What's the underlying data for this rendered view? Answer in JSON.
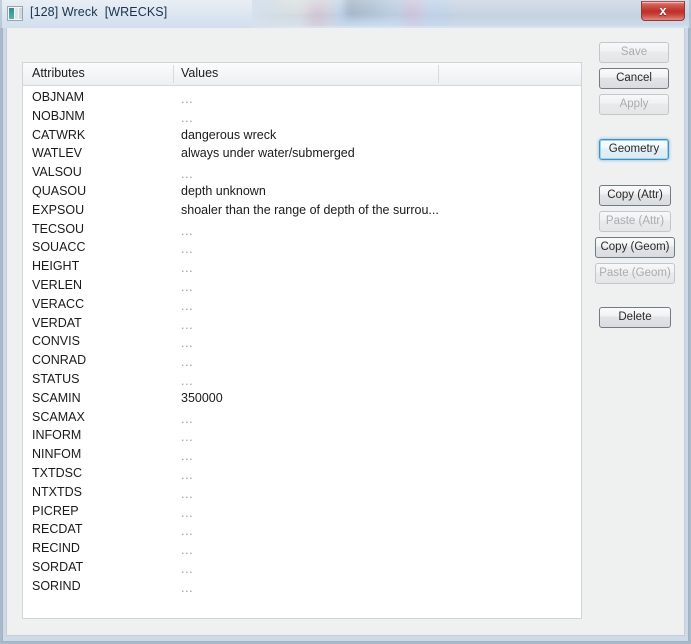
{
  "window": {
    "title": "[128] Wreck  [WRECKS]",
    "icon": "app-icon",
    "close_label": "x"
  },
  "table": {
    "headers": [
      "Attributes",
      "Values",
      ""
    ],
    "empty_marker": "...",
    "rows": [
      {
        "attribute": "OBJNAM",
        "value": "...",
        "empty": true
      },
      {
        "attribute": "NOBJNM",
        "value": "...",
        "empty": true
      },
      {
        "attribute": "CATWRK",
        "value": "dangerous wreck",
        "empty": false
      },
      {
        "attribute": "WATLEV",
        "value": "always under water/submerged",
        "empty": false
      },
      {
        "attribute": "VALSOU",
        "value": "...",
        "empty": true
      },
      {
        "attribute": "QUASOU",
        "value": "depth unknown",
        "empty": false
      },
      {
        "attribute": "EXPSOU",
        "value": "shoaler than the range of depth of the surrou...",
        "empty": false
      },
      {
        "attribute": "TECSOU",
        "value": "...",
        "empty": true
      },
      {
        "attribute": "SOUACC",
        "value": "...",
        "empty": true
      },
      {
        "attribute": "HEIGHT",
        "value": "...",
        "empty": true
      },
      {
        "attribute": "VERLEN",
        "value": "...",
        "empty": true
      },
      {
        "attribute": "VERACC",
        "value": "...",
        "empty": true
      },
      {
        "attribute": "VERDAT",
        "value": "...",
        "empty": true
      },
      {
        "attribute": "CONVIS",
        "value": "...",
        "empty": true
      },
      {
        "attribute": "CONRAD",
        "value": "...",
        "empty": true
      },
      {
        "attribute": "STATUS",
        "value": "...",
        "empty": true
      },
      {
        "attribute": "SCAMIN",
        "value": "350000",
        "empty": false
      },
      {
        "attribute": "SCAMAX",
        "value": "...",
        "empty": true
      },
      {
        "attribute": "INFORM",
        "value": "...",
        "empty": true
      },
      {
        "attribute": "NINFOM",
        "value": "...",
        "empty": true
      },
      {
        "attribute": "TXTDSC",
        "value": "...",
        "empty": true
      },
      {
        "attribute": "NTXTDS",
        "value": "...",
        "empty": true
      },
      {
        "attribute": "PICREP",
        "value": "...",
        "empty": true
      },
      {
        "attribute": "RECDAT",
        "value": "...",
        "empty": true
      },
      {
        "attribute": "RECIND",
        "value": "...",
        "empty": true
      },
      {
        "attribute": "SORDAT",
        "value": "...",
        "empty": true
      },
      {
        "attribute": "SORIND",
        "value": "...",
        "empty": true
      }
    ]
  },
  "buttons": {
    "save": {
      "label": "Save",
      "state": "disabled"
    },
    "cancel": {
      "label": "Cancel",
      "state": "default"
    },
    "apply": {
      "label": "Apply",
      "state": "disabled"
    },
    "geometry": {
      "label": "Geometry",
      "state": "focused"
    },
    "copy_attr": {
      "label": "Copy (Attr)",
      "state": "default"
    },
    "paste_attr": {
      "label": "Paste (Attr)",
      "state": "disabled"
    },
    "copy_geom": {
      "label": "Copy (Geom)",
      "state": "default"
    },
    "paste_geom": {
      "label": "Paste (Geom)",
      "state": "disabled"
    },
    "delete": {
      "label": "Delete",
      "state": "default"
    }
  },
  "colors": {
    "close_button": "#bd2f27",
    "focus_ring": "#3c93c2",
    "panel_background": "#ffffff",
    "window_background": "#eff0f0",
    "title_text": "#17334e"
  }
}
